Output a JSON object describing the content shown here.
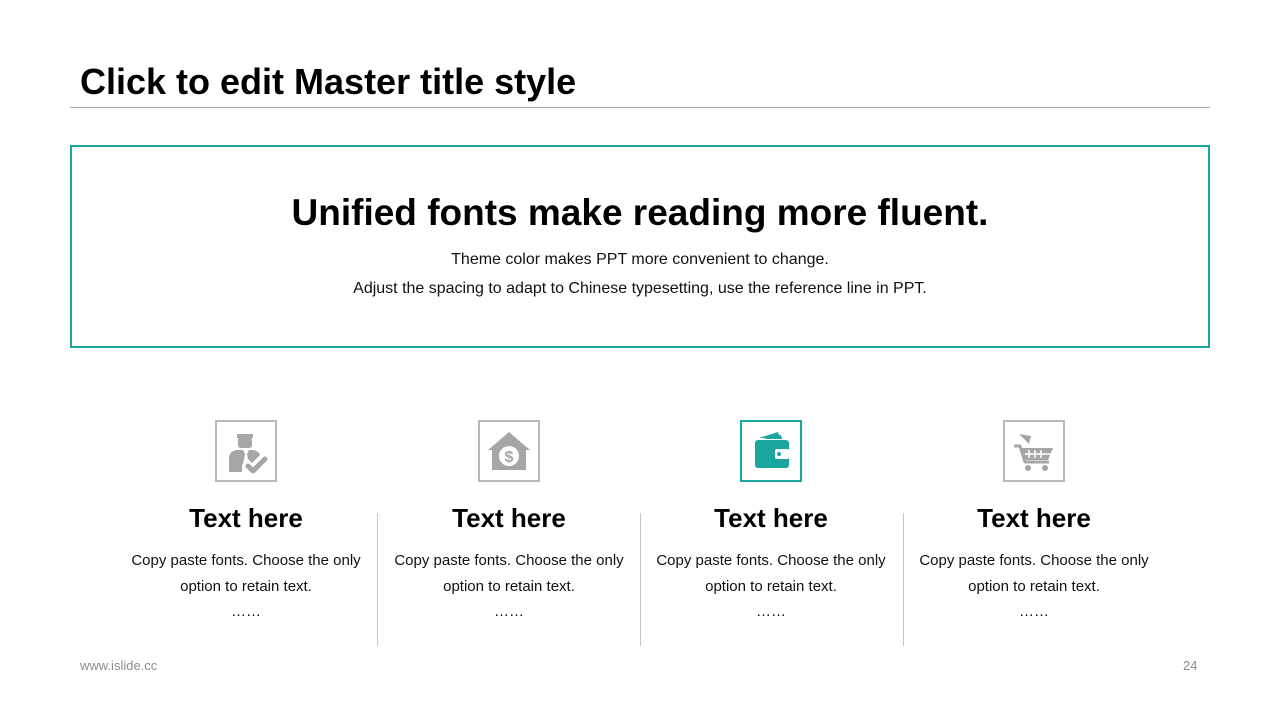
{
  "slide": {
    "title": "Click to edit Master title style",
    "banner": {
      "heading": "Unified fonts make reading more fluent.",
      "line1": "Theme color makes PPT more convenient to change.",
      "line2": "Adjust the spacing to adapt to Chinese typesetting, use the reference line in PPT."
    },
    "columns": [
      {
        "icon": "businessman-check-icon",
        "heading": "Text here",
        "text": "Copy paste fonts. Choose the only option to retain text.",
        "dots": "……",
        "highlighted": false
      },
      {
        "icon": "house-dollar-icon",
        "heading": "Text here",
        "text": "Copy paste fonts. Choose the only option to retain text.",
        "dots": "……",
        "highlighted": false
      },
      {
        "icon": "wallet-icon",
        "heading": "Text here",
        "text": "Copy paste fonts. Choose the only option to retain text.",
        "dots": "……",
        "highlighted": true
      },
      {
        "icon": "shopping-cart-icon",
        "heading": "Text here",
        "text": "Copy paste fonts. Choose the only option to retain text.",
        "dots": "……",
        "highlighted": false
      }
    ]
  },
  "footer": {
    "website": "www.islide.cc",
    "page_number": "24"
  },
  "colors": {
    "accent": "#1aa59e",
    "icon_gray": "#a6a6a6",
    "divider": "#c8c8c8"
  }
}
